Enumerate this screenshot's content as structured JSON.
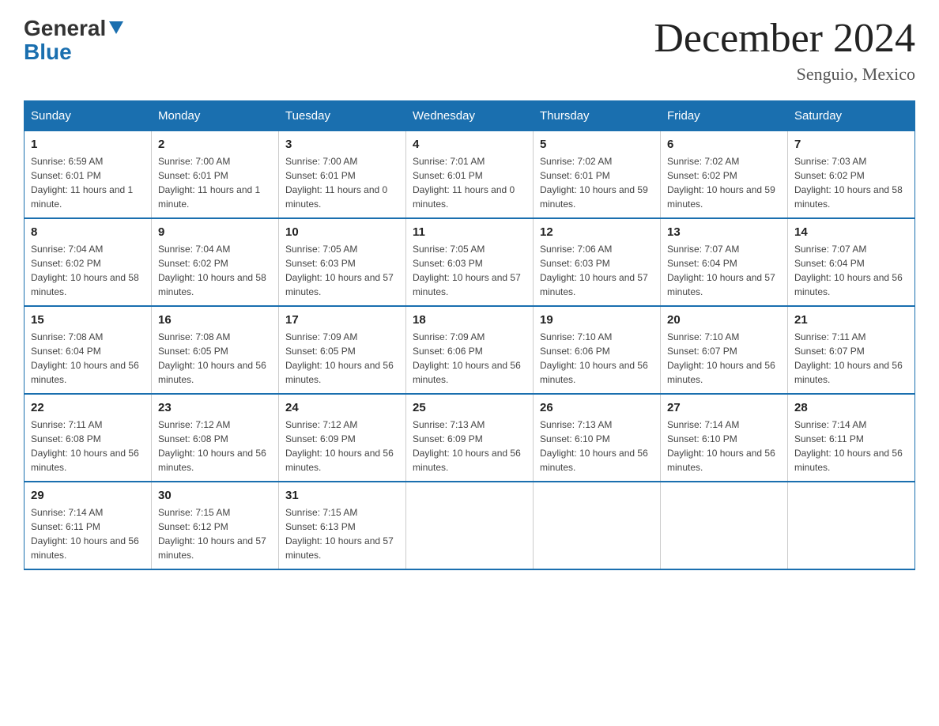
{
  "logo": {
    "general": "General",
    "blue": "Blue",
    "arrow": "▼"
  },
  "title": "December 2024",
  "location": "Senguio, Mexico",
  "days_of_week": [
    "Sunday",
    "Monday",
    "Tuesday",
    "Wednesday",
    "Thursday",
    "Friday",
    "Saturday"
  ],
  "weeks": [
    [
      {
        "day": "1",
        "sunrise": "Sunrise: 6:59 AM",
        "sunset": "Sunset: 6:01 PM",
        "daylight": "Daylight: 11 hours and 1 minute."
      },
      {
        "day": "2",
        "sunrise": "Sunrise: 7:00 AM",
        "sunset": "Sunset: 6:01 PM",
        "daylight": "Daylight: 11 hours and 1 minute."
      },
      {
        "day": "3",
        "sunrise": "Sunrise: 7:00 AM",
        "sunset": "Sunset: 6:01 PM",
        "daylight": "Daylight: 11 hours and 0 minutes."
      },
      {
        "day": "4",
        "sunrise": "Sunrise: 7:01 AM",
        "sunset": "Sunset: 6:01 PM",
        "daylight": "Daylight: 11 hours and 0 minutes."
      },
      {
        "day": "5",
        "sunrise": "Sunrise: 7:02 AM",
        "sunset": "Sunset: 6:01 PM",
        "daylight": "Daylight: 10 hours and 59 minutes."
      },
      {
        "day": "6",
        "sunrise": "Sunrise: 7:02 AM",
        "sunset": "Sunset: 6:02 PM",
        "daylight": "Daylight: 10 hours and 59 minutes."
      },
      {
        "day": "7",
        "sunrise": "Sunrise: 7:03 AM",
        "sunset": "Sunset: 6:02 PM",
        "daylight": "Daylight: 10 hours and 58 minutes."
      }
    ],
    [
      {
        "day": "8",
        "sunrise": "Sunrise: 7:04 AM",
        "sunset": "Sunset: 6:02 PM",
        "daylight": "Daylight: 10 hours and 58 minutes."
      },
      {
        "day": "9",
        "sunrise": "Sunrise: 7:04 AM",
        "sunset": "Sunset: 6:02 PM",
        "daylight": "Daylight: 10 hours and 58 minutes."
      },
      {
        "day": "10",
        "sunrise": "Sunrise: 7:05 AM",
        "sunset": "Sunset: 6:03 PM",
        "daylight": "Daylight: 10 hours and 57 minutes."
      },
      {
        "day": "11",
        "sunrise": "Sunrise: 7:05 AM",
        "sunset": "Sunset: 6:03 PM",
        "daylight": "Daylight: 10 hours and 57 minutes."
      },
      {
        "day": "12",
        "sunrise": "Sunrise: 7:06 AM",
        "sunset": "Sunset: 6:03 PM",
        "daylight": "Daylight: 10 hours and 57 minutes."
      },
      {
        "day": "13",
        "sunrise": "Sunrise: 7:07 AM",
        "sunset": "Sunset: 6:04 PM",
        "daylight": "Daylight: 10 hours and 57 minutes."
      },
      {
        "day": "14",
        "sunrise": "Sunrise: 7:07 AM",
        "sunset": "Sunset: 6:04 PM",
        "daylight": "Daylight: 10 hours and 56 minutes."
      }
    ],
    [
      {
        "day": "15",
        "sunrise": "Sunrise: 7:08 AM",
        "sunset": "Sunset: 6:04 PM",
        "daylight": "Daylight: 10 hours and 56 minutes."
      },
      {
        "day": "16",
        "sunrise": "Sunrise: 7:08 AM",
        "sunset": "Sunset: 6:05 PM",
        "daylight": "Daylight: 10 hours and 56 minutes."
      },
      {
        "day": "17",
        "sunrise": "Sunrise: 7:09 AM",
        "sunset": "Sunset: 6:05 PM",
        "daylight": "Daylight: 10 hours and 56 minutes."
      },
      {
        "day": "18",
        "sunrise": "Sunrise: 7:09 AM",
        "sunset": "Sunset: 6:06 PM",
        "daylight": "Daylight: 10 hours and 56 minutes."
      },
      {
        "day": "19",
        "sunrise": "Sunrise: 7:10 AM",
        "sunset": "Sunset: 6:06 PM",
        "daylight": "Daylight: 10 hours and 56 minutes."
      },
      {
        "day": "20",
        "sunrise": "Sunrise: 7:10 AM",
        "sunset": "Sunset: 6:07 PM",
        "daylight": "Daylight: 10 hours and 56 minutes."
      },
      {
        "day": "21",
        "sunrise": "Sunrise: 7:11 AM",
        "sunset": "Sunset: 6:07 PM",
        "daylight": "Daylight: 10 hours and 56 minutes."
      }
    ],
    [
      {
        "day": "22",
        "sunrise": "Sunrise: 7:11 AM",
        "sunset": "Sunset: 6:08 PM",
        "daylight": "Daylight: 10 hours and 56 minutes."
      },
      {
        "day": "23",
        "sunrise": "Sunrise: 7:12 AM",
        "sunset": "Sunset: 6:08 PM",
        "daylight": "Daylight: 10 hours and 56 minutes."
      },
      {
        "day": "24",
        "sunrise": "Sunrise: 7:12 AM",
        "sunset": "Sunset: 6:09 PM",
        "daylight": "Daylight: 10 hours and 56 minutes."
      },
      {
        "day": "25",
        "sunrise": "Sunrise: 7:13 AM",
        "sunset": "Sunset: 6:09 PM",
        "daylight": "Daylight: 10 hours and 56 minutes."
      },
      {
        "day": "26",
        "sunrise": "Sunrise: 7:13 AM",
        "sunset": "Sunset: 6:10 PM",
        "daylight": "Daylight: 10 hours and 56 minutes."
      },
      {
        "day": "27",
        "sunrise": "Sunrise: 7:14 AM",
        "sunset": "Sunset: 6:10 PM",
        "daylight": "Daylight: 10 hours and 56 minutes."
      },
      {
        "day": "28",
        "sunrise": "Sunrise: 7:14 AM",
        "sunset": "Sunset: 6:11 PM",
        "daylight": "Daylight: 10 hours and 56 minutes."
      }
    ],
    [
      {
        "day": "29",
        "sunrise": "Sunrise: 7:14 AM",
        "sunset": "Sunset: 6:11 PM",
        "daylight": "Daylight: 10 hours and 56 minutes."
      },
      {
        "day": "30",
        "sunrise": "Sunrise: 7:15 AM",
        "sunset": "Sunset: 6:12 PM",
        "daylight": "Daylight: 10 hours and 57 minutes."
      },
      {
        "day": "31",
        "sunrise": "Sunrise: 7:15 AM",
        "sunset": "Sunset: 6:13 PM",
        "daylight": "Daylight: 10 hours and 57 minutes."
      },
      null,
      null,
      null,
      null
    ]
  ]
}
